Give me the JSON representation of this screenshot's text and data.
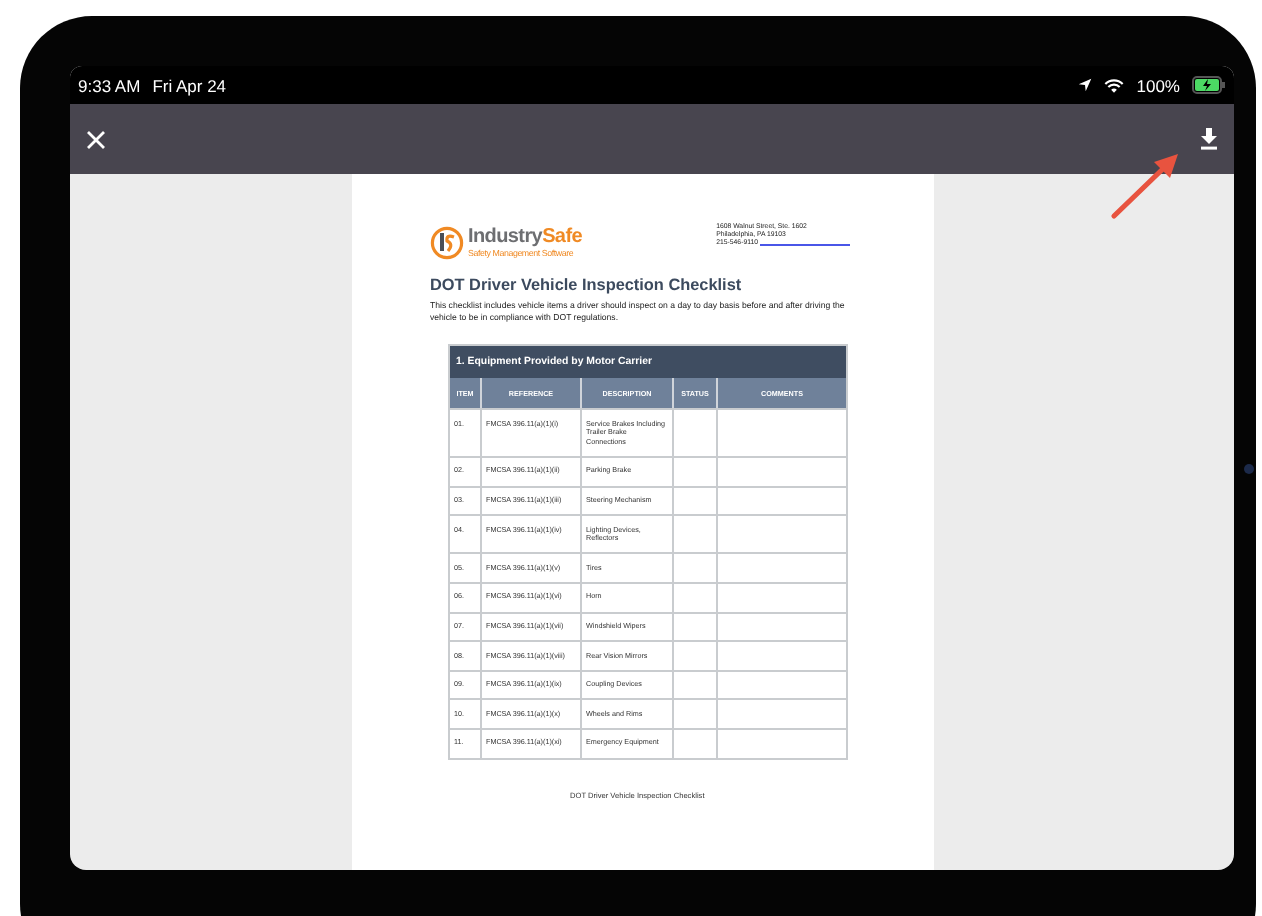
{
  "status_bar": {
    "time": "9:33 AM",
    "date": "Fri Apr 24",
    "battery": "100%"
  },
  "document": {
    "logo": {
      "word_1": "Industry",
      "word_2": "Safe",
      "tagline": "Safety Management Software"
    },
    "address": [
      "1608 Walnut Street, Ste. 1602",
      "Philadelphia, PA 19103",
      "215-546-9110"
    ],
    "title": "DOT Driver Vehicle Inspection Checklist",
    "intro": "This checklist includes vehicle items a driver should inspect on a day to day basis before and after driving the vehicle to be in compliance with DOT regulations.",
    "table": {
      "title": "1. Equipment Provided by Motor Carrier",
      "columns": [
        "ITEM",
        "REFERENCE",
        "DESCRIPTION",
        "STATUS",
        "COMMENTS"
      ],
      "rows": [
        {
          "item": "01.",
          "reference": "FMCSA 396.11(a)(1)(i)",
          "description": "Service Brakes Including Trailer Brake Connections"
        },
        {
          "item": "02.",
          "reference": "FMCSA 396.11(a)(1)(ii)",
          "description": "Parking Brake"
        },
        {
          "item": "03.",
          "reference": "FMCSA 396.11(a)(1)(iii)",
          "description": "Steering Mechanism"
        },
        {
          "item": "04.",
          "reference": "FMCSA 396.11(a)(1)(iv)",
          "description": "Lighting Devices, Reflectors"
        },
        {
          "item": "05.",
          "reference": "FMCSA 396.11(a)(1)(v)",
          "description": "Tires"
        },
        {
          "item": "06.",
          "reference": "FMCSA 396.11(a)(1)(vi)",
          "description": "Horn"
        },
        {
          "item": "07.",
          "reference": "FMCSA 396.11(a)(1)(vii)",
          "description": "Windshield Wipers"
        },
        {
          "item": "08.",
          "reference": "FMCSA 396.11(a)(1)(viii)",
          "description": "Rear Vision Mirrors"
        },
        {
          "item": "09.",
          "reference": "FMCSA 396.11(a)(1)(ix)",
          "description": "Coupling Devices"
        },
        {
          "item": "10.",
          "reference": "FMCSA 396.11(a)(1)(x)",
          "description": "Wheels and Rims"
        },
        {
          "item": "11.",
          "reference": "FMCSA 396.11(a)(1)(xi)",
          "description": "Emergency Equipment"
        }
      ]
    },
    "footer": "DOT Driver Vehicle Inspection Checklist"
  }
}
